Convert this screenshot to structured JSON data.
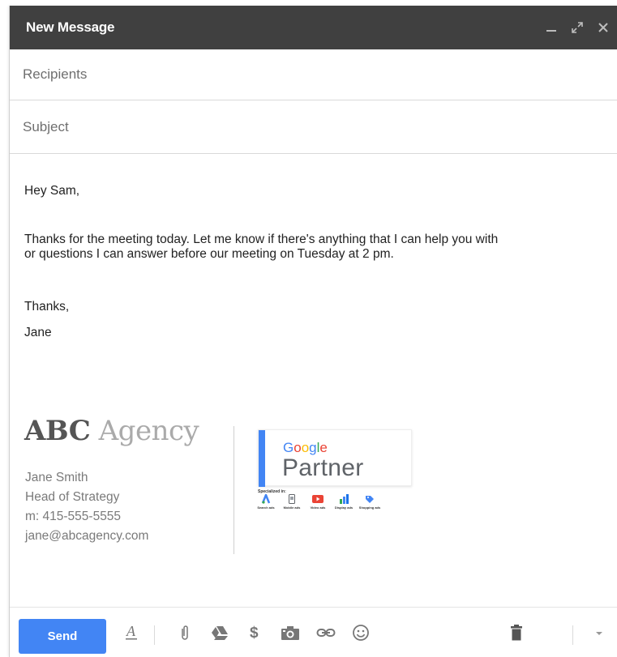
{
  "window": {
    "title": "New Message"
  },
  "compose": {
    "recipients_placeholder": "Recipients",
    "subject_placeholder": "Subject",
    "body": {
      "greeting": "Hey Sam,",
      "paragraph_line1": "Thanks for the meeting today. Let me know if there's anything that I can help you with",
      "paragraph_line2": "or questions I can answer before our meeting on Tuesday at 2 pm.",
      "closing": "Thanks,",
      "signer": "Jane"
    }
  },
  "signature": {
    "logo_strong": "ABC",
    "logo_light": "Agency",
    "name": "Jane Smith",
    "role": "Head of Strategy",
    "phone": "m: 415-555-5555",
    "email": "jane@abcagency.com",
    "badge": {
      "brand": "Google",
      "label": "Partner",
      "specialized_label": "Specialized in:",
      "specializations": [
        "Search ads",
        "Mobile ads",
        "Video ads",
        "Display ads",
        "Shopping ads"
      ]
    }
  },
  "toolbar": {
    "send_label": "Send",
    "icons": [
      "formatting-icon",
      "attach-icon",
      "drive-icon",
      "money-icon",
      "photo-icon",
      "link-icon",
      "emoji-icon",
      "trash-icon",
      "more-options-icon"
    ]
  },
  "colors": {
    "titlebar": "#404040",
    "send": "#4285f4",
    "badge_bar": "#4285f4"
  }
}
